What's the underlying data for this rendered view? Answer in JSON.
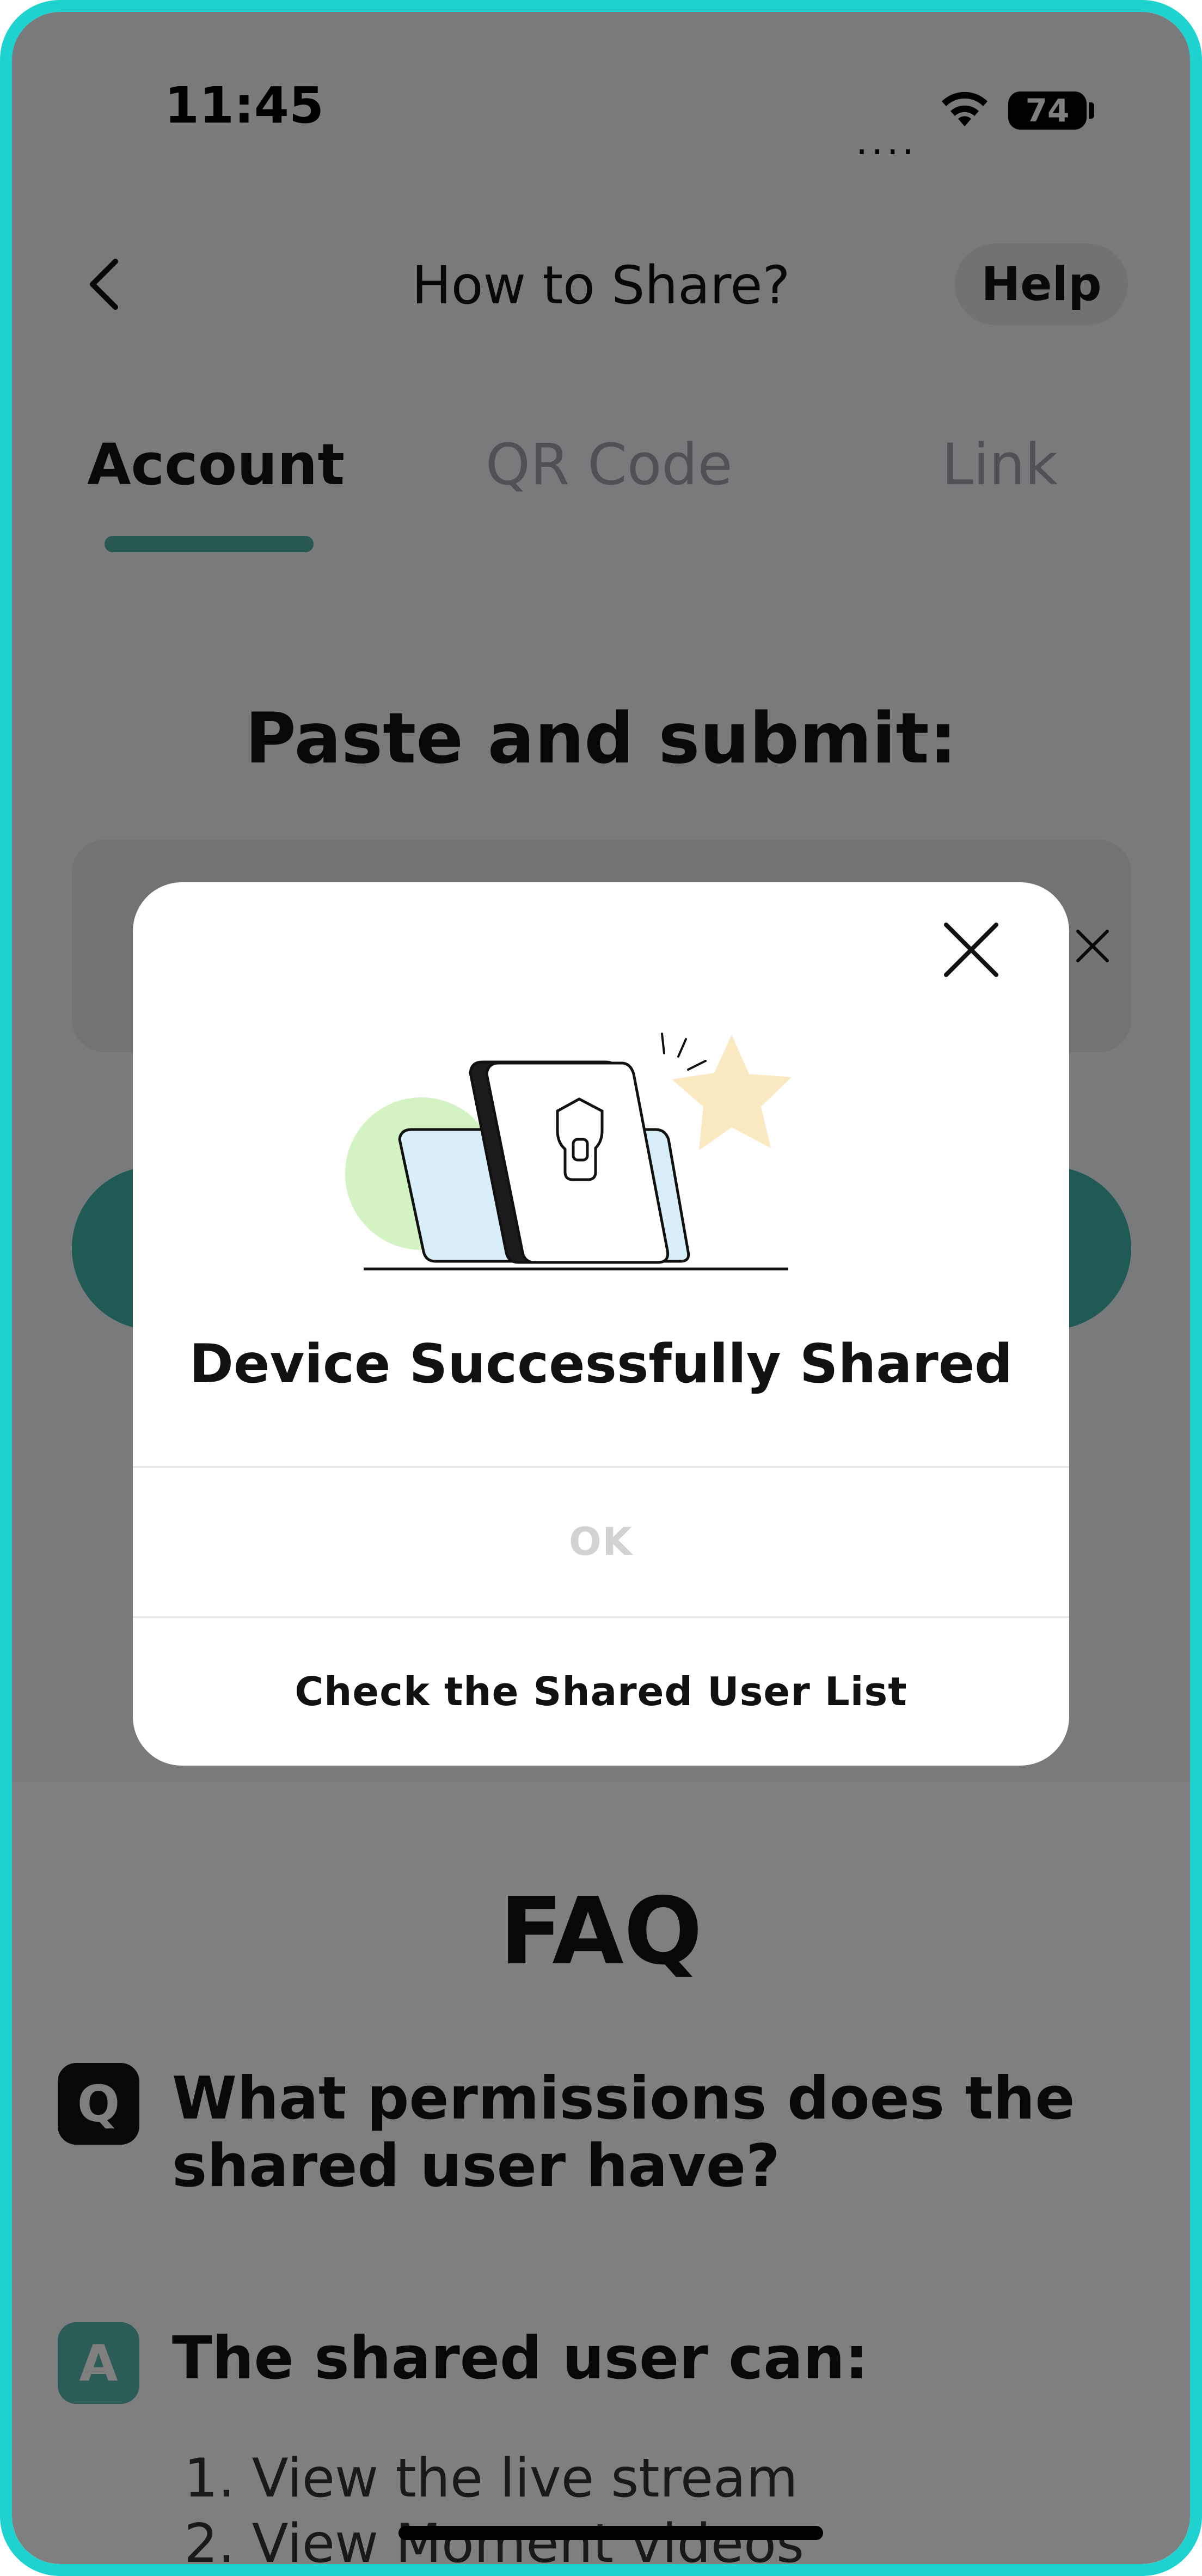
{
  "status_bar": {
    "time": "11:45",
    "signal": "....",
    "battery": "74"
  },
  "header": {
    "title": "How to Share?",
    "help_label": "Help"
  },
  "tabs": [
    {
      "label": "Account",
      "active": true
    },
    {
      "label": "QR Code",
      "active": false
    },
    {
      "label": "Link",
      "active": false
    }
  ],
  "main": {
    "heading": "Paste and submit:"
  },
  "faq": {
    "title": "FAQ",
    "q_badge": "Q",
    "question": "What permissions does the shared user have?",
    "a_badge": "A",
    "answer_heading": "The shared user can:",
    "answer_items": [
      "1. View the live stream",
      "2. View Moment videos"
    ]
  },
  "modal": {
    "title": "Device Successfully Shared",
    "ok_label": "OK",
    "check_label": "Check the Shared User List"
  },
  "colors": {
    "accent": "#3fb7a8",
    "frame_border": "#1ed3cf",
    "overlay": "rgba(0,0,0,0.5)"
  }
}
